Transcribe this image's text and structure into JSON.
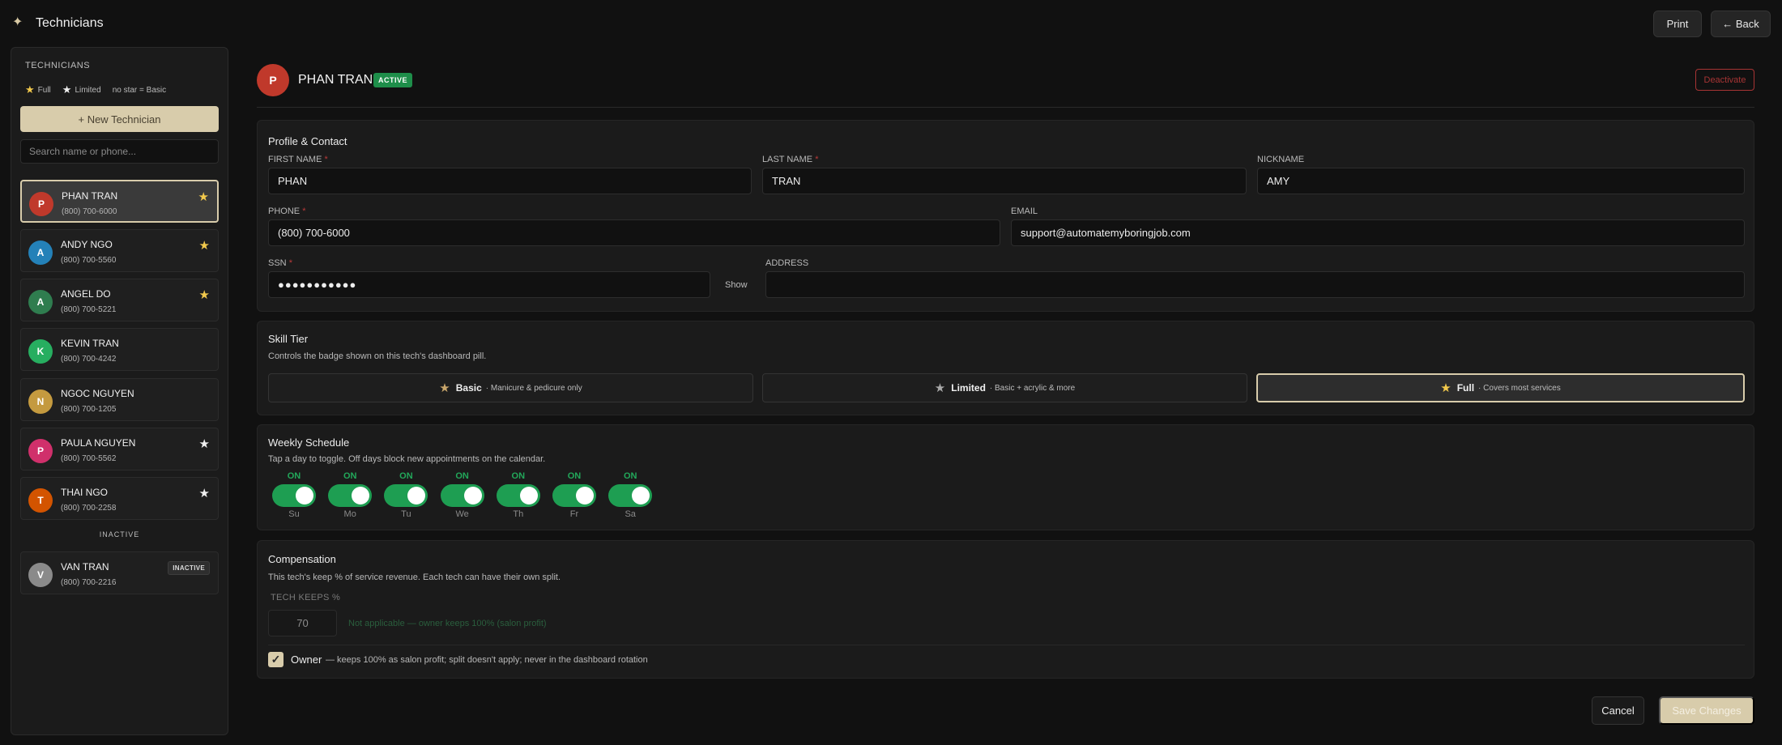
{
  "app": {
    "title": "Technicians",
    "logo_icon": "sparkle-icon"
  },
  "toolbar": {
    "print_label": "Print",
    "back_label": "← Back"
  },
  "sidebar": {
    "heading": "TECHNICIANS",
    "legend": {
      "full": "Full",
      "limited": "Limited",
      "basic": "no star = Basic"
    },
    "new_button": "+ New Technician",
    "search_placeholder": "Search name or phone...",
    "inactive_heading": "INACTIVE",
    "technicians": [
      {
        "initial": "P",
        "name": "PHAN TRAN",
        "phone": "(800) 700-6000",
        "tier": "full",
        "color": "#c0392b",
        "selected": true
      },
      {
        "initial": "A",
        "name": "ANDY NGO",
        "phone": "(800) 700-5560",
        "tier": "full",
        "color": "#2481b8"
      },
      {
        "initial": "A",
        "name": "ANGEL DO",
        "phone": "(800) 700-5221",
        "tier": "full",
        "color": "#2f7d4f"
      },
      {
        "initial": "K",
        "name": "KEVIN TRAN",
        "phone": "(800) 700-4242",
        "tier": "basic",
        "color": "#27ae60"
      },
      {
        "initial": "N",
        "name": "NGOC NGUYEN",
        "phone": "(800) 700-1205",
        "tier": "basic",
        "color": "#c49a3f"
      },
      {
        "initial": "P",
        "name": "PAULA NGUYEN",
        "phone": "(800) 700-5562",
        "tier": "limited",
        "color": "#d0306b"
      },
      {
        "initial": "T",
        "name": "THAI NGO",
        "phone": "(800) 700-2258",
        "tier": "limited",
        "color": "#d35400"
      }
    ],
    "inactive": [
      {
        "initial": "V",
        "name": "VAN TRAN",
        "phone": "(800) 700-2216",
        "badge": "INACTIVE",
        "color": "#8a8a8a"
      }
    ]
  },
  "header": {
    "initial": "P",
    "name": "PHAN TRAN",
    "status": "ACTIVE",
    "deactivate_label": "Deactivate",
    "avatar_color": "#c0392b"
  },
  "profile": {
    "title": "Profile & Contact",
    "first_name_label": "FIRST NAME",
    "first_name": "PHAN",
    "last_name_label": "LAST NAME",
    "last_name": "TRAN",
    "nickname_label": "NICKNAME",
    "nickname": "AMY",
    "phone_label": "PHONE",
    "phone": "(800) 700-6000",
    "email_label": "EMAIL",
    "email": "support@automatemyboringjob.com",
    "ssn_label": "SSN",
    "ssn": "●●●●●●●●●●●",
    "ssn_show": "Show",
    "address_label": "ADDRESS",
    "address": "",
    "required_mark": "*"
  },
  "skill": {
    "title": "Skill Tier",
    "subtitle": "Controls the badge shown on this tech's dashboard pill.",
    "tiers": [
      {
        "label": "Basic",
        "desc": "· Manicure & pedicure only"
      },
      {
        "label": "Limited",
        "desc": "· Basic + acrylic & more"
      },
      {
        "label": "Full",
        "desc": "· Covers most services"
      }
    ],
    "selected": "Full"
  },
  "schedule": {
    "title": "Weekly Schedule",
    "subtitle": "Tap a day to toggle. Off days block new appointments on the calendar.",
    "days": [
      {
        "name": "Su",
        "state": "ON"
      },
      {
        "name": "Mo",
        "state": "ON"
      },
      {
        "name": "Tu",
        "state": "ON"
      },
      {
        "name": "We",
        "state": "ON"
      },
      {
        "name": "Th",
        "state": "ON"
      },
      {
        "name": "Fr",
        "state": "ON"
      },
      {
        "name": "Sa",
        "state": "ON"
      }
    ]
  },
  "compensation": {
    "title": "Compensation",
    "subtitle": "This tech's keep % of service revenue. Each tech can have their own split.",
    "keeps_label": "TECH KEEPS %",
    "keeps_value": "70",
    "not_applicable": "Not applicable — owner keeps 100% (salon profit)",
    "owner_checked": true,
    "owner_label": "Owner",
    "owner_desc": "— keeps 100% as salon profit; split doesn't apply; never in the dashboard rotation"
  },
  "footer": {
    "cancel_label": "Cancel",
    "save_label": "Save Changes"
  },
  "colors": {
    "accent": "#d8ccab",
    "active_green": "#1e8e4a",
    "danger": "#a73434",
    "star_gold": "#f2c94c"
  }
}
